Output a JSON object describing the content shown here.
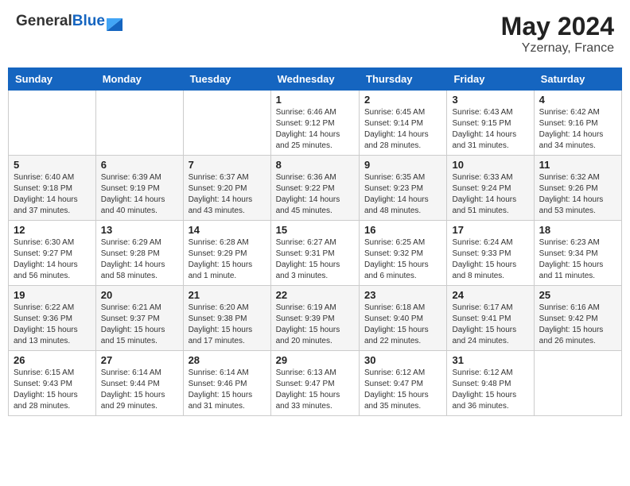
{
  "header": {
    "logo_general": "General",
    "logo_blue": "Blue",
    "month_year": "May 2024",
    "location": "Yzernay, France"
  },
  "days_of_week": [
    "Sunday",
    "Monday",
    "Tuesday",
    "Wednesday",
    "Thursday",
    "Friday",
    "Saturday"
  ],
  "weeks": [
    [
      {
        "day": "",
        "sunrise": "",
        "sunset": "",
        "daylight": ""
      },
      {
        "day": "",
        "sunrise": "",
        "sunset": "",
        "daylight": ""
      },
      {
        "day": "",
        "sunrise": "",
        "sunset": "",
        "daylight": ""
      },
      {
        "day": "1",
        "sunrise": "Sunrise: 6:46 AM",
        "sunset": "Sunset: 9:12 PM",
        "daylight": "Daylight: 14 hours and 25 minutes."
      },
      {
        "day": "2",
        "sunrise": "Sunrise: 6:45 AM",
        "sunset": "Sunset: 9:14 PM",
        "daylight": "Daylight: 14 hours and 28 minutes."
      },
      {
        "day": "3",
        "sunrise": "Sunrise: 6:43 AM",
        "sunset": "Sunset: 9:15 PM",
        "daylight": "Daylight: 14 hours and 31 minutes."
      },
      {
        "day": "4",
        "sunrise": "Sunrise: 6:42 AM",
        "sunset": "Sunset: 9:16 PM",
        "daylight": "Daylight: 14 hours and 34 minutes."
      }
    ],
    [
      {
        "day": "5",
        "sunrise": "Sunrise: 6:40 AM",
        "sunset": "Sunset: 9:18 PM",
        "daylight": "Daylight: 14 hours and 37 minutes."
      },
      {
        "day": "6",
        "sunrise": "Sunrise: 6:39 AM",
        "sunset": "Sunset: 9:19 PM",
        "daylight": "Daylight: 14 hours and 40 minutes."
      },
      {
        "day": "7",
        "sunrise": "Sunrise: 6:37 AM",
        "sunset": "Sunset: 9:20 PM",
        "daylight": "Daylight: 14 hours and 43 minutes."
      },
      {
        "day": "8",
        "sunrise": "Sunrise: 6:36 AM",
        "sunset": "Sunset: 9:22 PM",
        "daylight": "Daylight: 14 hours and 45 minutes."
      },
      {
        "day": "9",
        "sunrise": "Sunrise: 6:35 AM",
        "sunset": "Sunset: 9:23 PM",
        "daylight": "Daylight: 14 hours and 48 minutes."
      },
      {
        "day": "10",
        "sunrise": "Sunrise: 6:33 AM",
        "sunset": "Sunset: 9:24 PM",
        "daylight": "Daylight: 14 hours and 51 minutes."
      },
      {
        "day": "11",
        "sunrise": "Sunrise: 6:32 AM",
        "sunset": "Sunset: 9:26 PM",
        "daylight": "Daylight: 14 hours and 53 minutes."
      }
    ],
    [
      {
        "day": "12",
        "sunrise": "Sunrise: 6:30 AM",
        "sunset": "Sunset: 9:27 PM",
        "daylight": "Daylight: 14 hours and 56 minutes."
      },
      {
        "day": "13",
        "sunrise": "Sunrise: 6:29 AM",
        "sunset": "Sunset: 9:28 PM",
        "daylight": "Daylight: 14 hours and 58 minutes."
      },
      {
        "day": "14",
        "sunrise": "Sunrise: 6:28 AM",
        "sunset": "Sunset: 9:29 PM",
        "daylight": "Daylight: 15 hours and 1 minute."
      },
      {
        "day": "15",
        "sunrise": "Sunrise: 6:27 AM",
        "sunset": "Sunset: 9:31 PM",
        "daylight": "Daylight: 15 hours and 3 minutes."
      },
      {
        "day": "16",
        "sunrise": "Sunrise: 6:25 AM",
        "sunset": "Sunset: 9:32 PM",
        "daylight": "Daylight: 15 hours and 6 minutes."
      },
      {
        "day": "17",
        "sunrise": "Sunrise: 6:24 AM",
        "sunset": "Sunset: 9:33 PM",
        "daylight": "Daylight: 15 hours and 8 minutes."
      },
      {
        "day": "18",
        "sunrise": "Sunrise: 6:23 AM",
        "sunset": "Sunset: 9:34 PM",
        "daylight": "Daylight: 15 hours and 11 minutes."
      }
    ],
    [
      {
        "day": "19",
        "sunrise": "Sunrise: 6:22 AM",
        "sunset": "Sunset: 9:36 PM",
        "daylight": "Daylight: 15 hours and 13 minutes."
      },
      {
        "day": "20",
        "sunrise": "Sunrise: 6:21 AM",
        "sunset": "Sunset: 9:37 PM",
        "daylight": "Daylight: 15 hours and 15 minutes."
      },
      {
        "day": "21",
        "sunrise": "Sunrise: 6:20 AM",
        "sunset": "Sunset: 9:38 PM",
        "daylight": "Daylight: 15 hours and 17 minutes."
      },
      {
        "day": "22",
        "sunrise": "Sunrise: 6:19 AM",
        "sunset": "Sunset: 9:39 PM",
        "daylight": "Daylight: 15 hours and 20 minutes."
      },
      {
        "day": "23",
        "sunrise": "Sunrise: 6:18 AM",
        "sunset": "Sunset: 9:40 PM",
        "daylight": "Daylight: 15 hours and 22 minutes."
      },
      {
        "day": "24",
        "sunrise": "Sunrise: 6:17 AM",
        "sunset": "Sunset: 9:41 PM",
        "daylight": "Daylight: 15 hours and 24 minutes."
      },
      {
        "day": "25",
        "sunrise": "Sunrise: 6:16 AM",
        "sunset": "Sunset: 9:42 PM",
        "daylight": "Daylight: 15 hours and 26 minutes."
      }
    ],
    [
      {
        "day": "26",
        "sunrise": "Sunrise: 6:15 AM",
        "sunset": "Sunset: 9:43 PM",
        "daylight": "Daylight: 15 hours and 28 minutes."
      },
      {
        "day": "27",
        "sunrise": "Sunrise: 6:14 AM",
        "sunset": "Sunset: 9:44 PM",
        "daylight": "Daylight: 15 hours and 29 minutes."
      },
      {
        "day": "28",
        "sunrise": "Sunrise: 6:14 AM",
        "sunset": "Sunset: 9:46 PM",
        "daylight": "Daylight: 15 hours and 31 minutes."
      },
      {
        "day": "29",
        "sunrise": "Sunrise: 6:13 AM",
        "sunset": "Sunset: 9:47 PM",
        "daylight": "Daylight: 15 hours and 33 minutes."
      },
      {
        "day": "30",
        "sunrise": "Sunrise: 6:12 AM",
        "sunset": "Sunset: 9:47 PM",
        "daylight": "Daylight: 15 hours and 35 minutes."
      },
      {
        "day": "31",
        "sunrise": "Sunrise: 6:12 AM",
        "sunset": "Sunset: 9:48 PM",
        "daylight": "Daylight: 15 hours and 36 minutes."
      },
      {
        "day": "",
        "sunrise": "",
        "sunset": "",
        "daylight": ""
      }
    ]
  ]
}
